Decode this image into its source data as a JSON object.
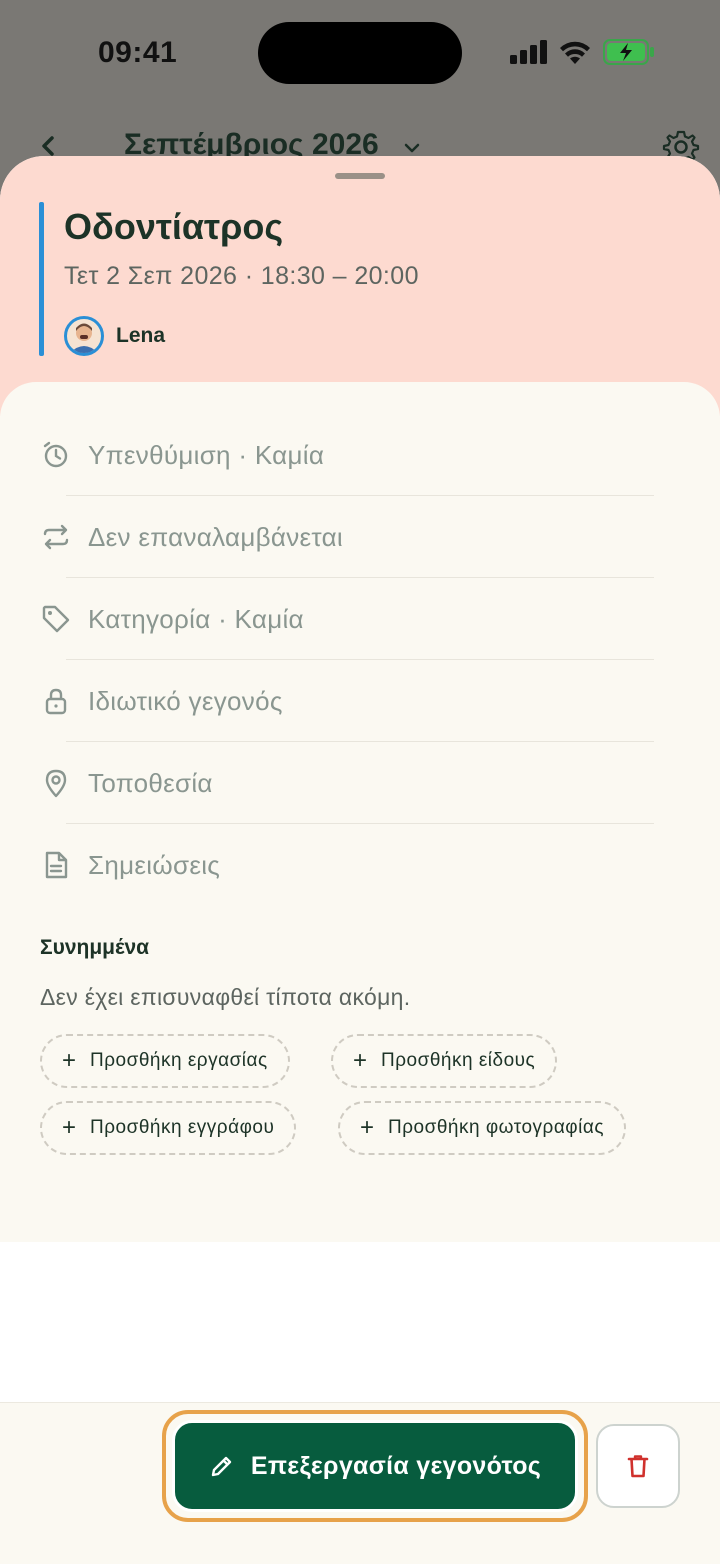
{
  "status_bar": {
    "time": "09:41"
  },
  "background_header": {
    "month": "Σεπτέμβριος 2026"
  },
  "event": {
    "title": "Οδοντίατρος",
    "datetime": "Τετ 2 Σεπ 2026 · 18:30 – 20:00",
    "owner": "Lena",
    "accent_color": "#2a8fd6",
    "header_color": "#fddad0"
  },
  "details": [
    {
      "icon": "alarm-clock-icon",
      "label": "Υπενθύμιση · Καμία"
    },
    {
      "icon": "repeat-icon",
      "label": "Δεν επαναλαμβάνεται"
    },
    {
      "icon": "tag-icon",
      "label": "Κατηγορία · Καμία"
    },
    {
      "icon": "lock-icon",
      "label": "Ιδιωτικό γεγονός"
    },
    {
      "icon": "location-pin-icon",
      "label": "Τοποθεσία"
    },
    {
      "icon": "document-icon",
      "label": "Σημειώσεις"
    }
  ],
  "attachments": {
    "title": "Συνημμένα",
    "empty_text": "Δεν έχει επισυναφθεί τίποτα ακόμη.",
    "chips": [
      {
        "plus": "+",
        "label": "Προσθήκη εργασίας"
      },
      {
        "plus": "+",
        "label": "Προσθήκη είδους"
      },
      {
        "plus": "+",
        "label": "Προσθήκη εγγράφου"
      },
      {
        "plus": "+",
        "label": "Προσθήκη φωτογραφίας"
      }
    ]
  },
  "footer": {
    "edit_label": "Επεξεργασία γεγονότος",
    "edit_color": "#075c3e",
    "delete_icon": "trash-icon",
    "delete_color": "#d0312d"
  }
}
